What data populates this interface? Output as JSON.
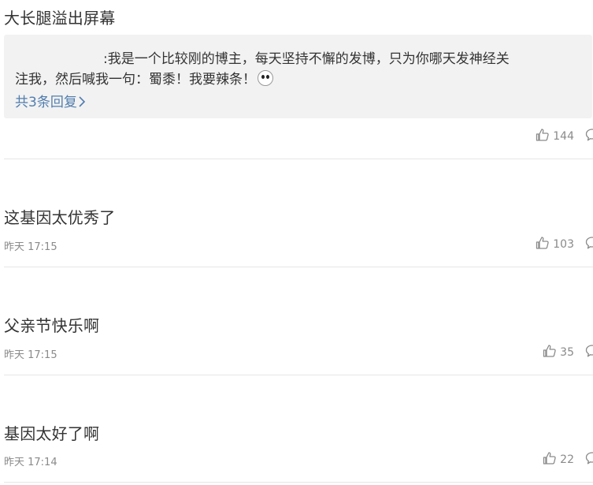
{
  "comments": [
    {
      "text": "大长腿溢出屏幕",
      "reply": {
        "author_redacted": true,
        "line1": ":我是一个比较刚的博主，每天坚持不懈的发博，只为你哪天发神经关",
        "line2": "注我，然后喊我一句：蜀黍！我要辣条！",
        "emoji": "panda-face-emoji",
        "more_label": "共3条回复",
        "more_icon": "chevron-right-icon"
      },
      "time": "",
      "likes": "144"
    },
    {
      "text": "这基因太优秀了",
      "time": "昨天 17:15",
      "likes": "103"
    },
    {
      "text": "父亲节快乐啊",
      "time": "昨天 17:15",
      "likes": "35"
    },
    {
      "text": "基因太好了啊",
      "time": "昨天 17:14",
      "likes": "22"
    }
  ],
  "icons": {
    "like": "thumbs-up-icon",
    "comment": "comment-bubble-icon"
  },
  "colors": {
    "link": "#507daf",
    "meta": "#8a8a8a",
    "text": "#333333",
    "reply_bg": "#f2f2f2"
  }
}
